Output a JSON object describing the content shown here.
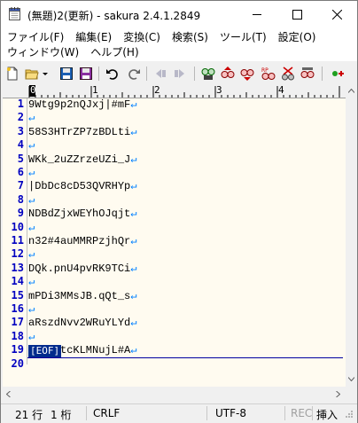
{
  "window": {
    "title": "(無題)2(更新) - sakura 2.4.1.2849"
  },
  "menu": {
    "row1": [
      "ファイル(F)",
      "編集(E)",
      "変換(C)",
      "検索(S)",
      "ツール(T)",
      "設定(O)"
    ],
    "row2": [
      "ウィンドウ(W)",
      "ヘルプ(H)"
    ]
  },
  "toolbar": {
    "icons": [
      "new-file-icon",
      "open-folder-icon",
      "dropdown-arrow-icon",
      "save-icon",
      "save-all-icon",
      "undo-icon",
      "redo-icon",
      "jump-back-icon",
      "jump-forward-icon",
      "search-icon",
      "find-prev-icon",
      "find-next-icon",
      "replace-icon",
      "clear-mark-icon",
      "grep-icon",
      "settings-icon"
    ]
  },
  "ruler": {
    "labels": [
      "0",
      "1",
      "2",
      "3",
      "4"
    ]
  },
  "editor": {
    "line_numbers": [
      "1",
      "2",
      "3",
      "4",
      "5",
      "6",
      "7",
      "8",
      "9",
      "10",
      "11",
      "12",
      "13",
      "14",
      "15",
      "16",
      "17",
      "18",
      "19",
      "20"
    ],
    "lines": [
      "9Wtg9p2nQJxj|#mF",
      "",
      "58S3HTrZP7zBDLti",
      "",
      "WKk_2uZZrzeUZi_J",
      "",
      "|DbDc8cD53QVRHYp",
      "",
      "NDBdZjxWEYhOJqjt",
      "",
      "n32#4auMMRPzjhQr",
      "",
      "DQk.pnU4pvRK9TCi",
      "",
      "mPDi3MMsJB.qQt_s",
      "",
      "aRszdNvv2WRuYLYd",
      "",
      "JW4CFtcKLMNujL#A",
      ""
    ],
    "newline_mark": "↵",
    "eof_label": "[EOF]"
  },
  "status": {
    "line": "21 行",
    "column": "1 桁",
    "newline": "CRLF",
    "encoding": "UTF-8",
    "rec": "REC",
    "mode": "挿入"
  },
  "colors": {
    "line_number": "#0000c0",
    "newline_mark": "#0080ff",
    "editor_bg": "#fffbf0",
    "eof_bg": "#002b8c"
  }
}
